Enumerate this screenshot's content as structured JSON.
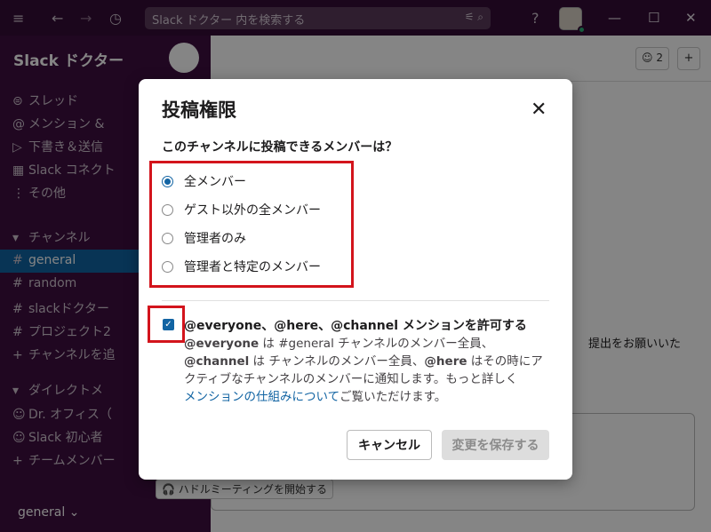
{
  "search": {
    "placeholder": "Slack ドクター 内を検索する"
  },
  "workspace": {
    "name": "Slack ドクター",
    "switcher_label": "general"
  },
  "sidebar": {
    "nav": [
      {
        "icon": "threads-icon",
        "glyph": "⊜",
        "label": "スレッド"
      },
      {
        "icon": "mention-icon",
        "glyph": "@",
        "label": "メンション &"
      },
      {
        "icon": "send-icon",
        "glyph": "▷",
        "label": "下書き＆送信"
      },
      {
        "icon": "connect-icon",
        "glyph": "▦",
        "label": "Slack コネクト"
      },
      {
        "icon": "more-icon",
        "glyph": "⋮",
        "label": "その他"
      }
    ],
    "channels_header": "チャンネル",
    "channels": [
      "general",
      "random",
      "slackドクター",
      "プロジェクト2"
    ],
    "add_channel": "チャンネルを追",
    "dm_header": "ダイレクトメ",
    "dms": [
      "Dr. オフィス（",
      "Slack 初心者"
    ],
    "add_member": "チームメンバー"
  },
  "main": {
    "member_count": "2",
    "message_snippet": "提出をお願いいた",
    "huddle_button": "ハドルミーティングを開始する"
  },
  "modal": {
    "title": "投稿権限",
    "question": "このチャンネルに投稿できるメンバーは？",
    "options": [
      "全メンバー",
      "ゲスト以外の全メンバー",
      "管理者のみ",
      "管理者と特定のメンバー"
    ],
    "selected_option": "全メンバー",
    "mention_toggle": {
      "checked": true,
      "title": "@everyone、@here、@channel メンションを許可する",
      "desc_b1": "@everyone",
      "desc_t1": " は #general チャンネルのメンバー全員、",
      "desc_b2": "@channel",
      "desc_t2": " は チャンネルのメンバー全員、",
      "desc_b3": "@here",
      "desc_t3": " はその時にアクティブなチャンネルのメンバーに通知します。もっと詳しく",
      "desc_link": "メンションの仕組みについて",
      "desc_t4": "ご覧いただけます。"
    },
    "cancel_label": "キャンセル",
    "save_label": "変更を保存する"
  }
}
